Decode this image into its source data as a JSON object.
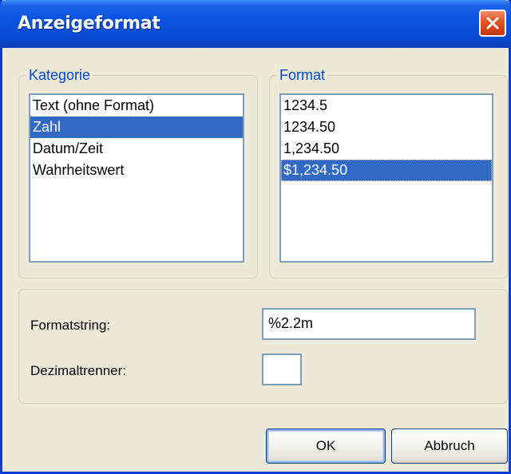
{
  "window": {
    "title": "Anzeigeformat",
    "close_icon": "close-icon"
  },
  "kategorie": {
    "legend": "Kategorie",
    "items": [
      "Text (ohne Format)",
      "Zahl",
      "Datum/Zeit",
      "Wahrheitswert"
    ],
    "selected": "Zahl"
  },
  "format": {
    "legend": "Format",
    "items": [
      "1234.5",
      "1234.50",
      "1,234.50",
      "$1,234.50"
    ],
    "selected": "$1,234.50"
  },
  "options": {
    "formatstring_label": "Formatstring:",
    "formatstring_value": "%2.2m",
    "dezimaltrenner_label": "Dezimaltrenner:",
    "dezimaltrenner_value": ""
  },
  "buttons": {
    "ok": "OK",
    "cancel": "Abbruch"
  },
  "colors": {
    "titlebar": "#0a55e0",
    "selection": "#316ac5",
    "legend_text": "#0046d5",
    "dialog_bg": "#ece9d8"
  }
}
